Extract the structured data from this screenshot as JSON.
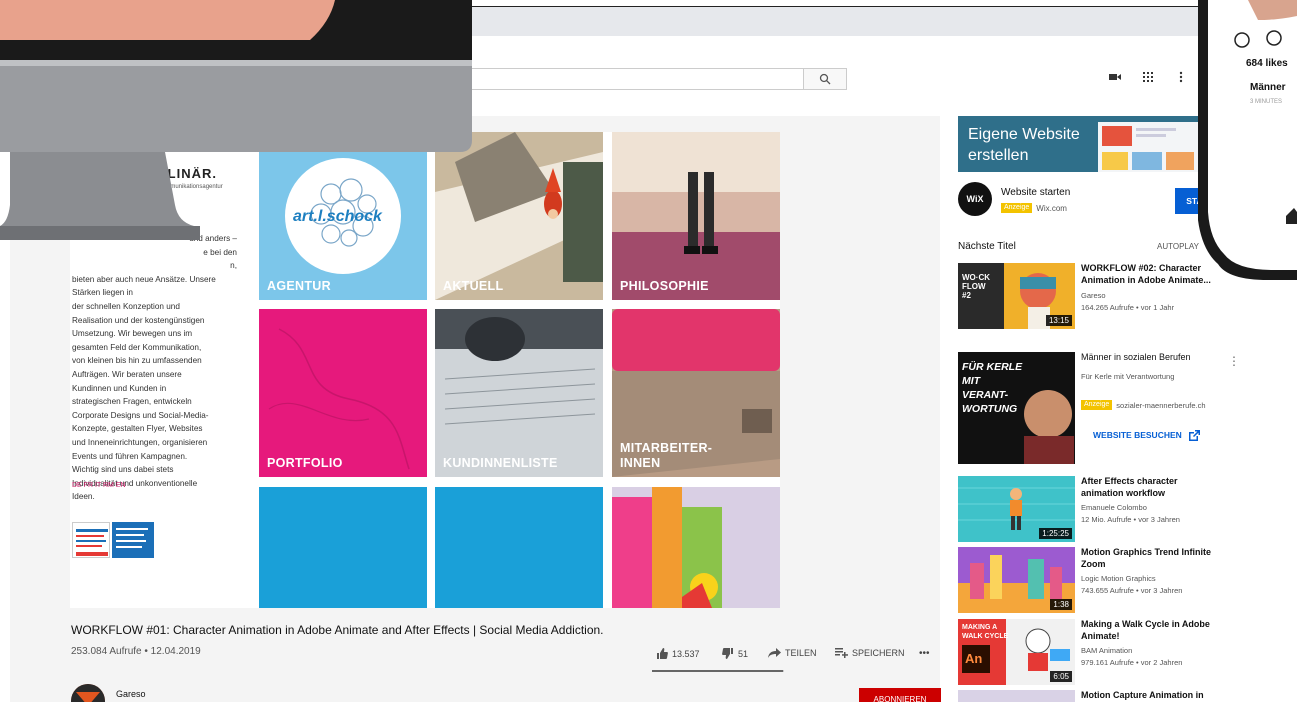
{
  "toolbar": {
    "search_icon": "search-icon",
    "icons": [
      "video-camera-icon",
      "apps-grid-icon",
      "more-vert-icon"
    ]
  },
  "website": {
    "title": "PLINÄR.",
    "subtitle": "Kommunikationsagentur",
    "text_lines": [
      "und anders –",
      "e bei den",
      "n,",
      "bieten aber auch neue Ansätze. Unsere Stärken liegen in",
      "der schnellen Konzeption und",
      "Realisation und der kostengünstigen",
      "Umsetzung. Wir bewegen uns im",
      "gesamten Feld der Kommunikation,",
      "von kleinen bis hin zu umfassenden",
      "Aufträgen. Wir beraten unsere",
      "Kundinnen und Kunden in",
      "strategischen Fragen, entwickeln",
      "Corporate Designs und Social-Media-",
      "Konzepte, gestalten Flyer, Websites",
      "und Inneneinrichtungen, organisieren",
      "Events und führen Kampagnen.",
      "Wichtig sind uns dabei stets",
      "Individualität und unkonventionelle",
      "Ideen."
    ],
    "languages": "DE FR IT RM EN",
    "logo_text": "art.l.schock",
    "tiles": [
      "AGENTUR",
      "AKTUELL",
      "PHILOSOPHIE",
      "PORTFOLIO",
      "KUNDINNENLISTE",
      "MITARBEITER-\nINNEN"
    ]
  },
  "video": {
    "title": "WORKFLOW #01: Character Animation in Adobe Animate and After Effects | Social Media Addiction.",
    "meta": "253.084 Aufrufe • 12.04.2019",
    "likes": "13.537",
    "dislikes": "51",
    "share": "TEILEN",
    "save": "SPEICHERN",
    "more": "•••",
    "like_ratio": 0.996,
    "channel": "Gareso",
    "subscribe": "ABONNIEREN"
  },
  "sidebar": {
    "ad_banner": {
      "text": "Eigene Website erstellen",
      "corner": "W"
    },
    "wix": {
      "logo": "WiX",
      "title": "Website starten",
      "badge": "Anzeige",
      "domain": "Wix.com",
      "button": "STARTEN"
    },
    "next_label": "Nächste Titel",
    "autoplay_label": "AUTOPLAY",
    "autoplay_on": true,
    "items": [
      {
        "title": "WORKFLOW #02: Character Animation in Adobe Animate...",
        "channel": "Gareso",
        "meta": "164.265 Aufrufe • vor 1 Jahr",
        "duration": "13:15",
        "thumb_text": "WO·CK\nFLOW\n#2"
      },
      {
        "title": "Männer in sozialen Berufen",
        "channel": "Für Kerle mit Verantwortung",
        "meta": "sozialer-maennerberufe.ch",
        "badge": "Anzeige",
        "button": "WEBSITE BESUCHEN",
        "thumb_text": "FÜR KERLE\nMIT\nVERANT-\nWORTUNG"
      },
      {
        "title": "After Effects character animation workflow",
        "channel": "Emanuele Colombo",
        "meta": "12 Mio. Aufrufe • vor 3 Jahren",
        "duration": "1:25:25"
      },
      {
        "title": "Motion Graphics Trend Infinite Zoom",
        "channel": "Logic Motion Graphics",
        "meta": "743.655 Aufrufe • vor 3 Jahren",
        "duration": "1:38"
      },
      {
        "title": "Making a Walk Cycle in Adobe Animate!",
        "channel": "BAM Animation",
        "meta": "979.161 Aufrufe • vor 2 Jahren",
        "duration": "6:05",
        "thumb_text": "MAKING A\nWALK CYCLE",
        "thumb_sub": "An"
      },
      {
        "title": "Motion Capture Animation in"
      }
    ]
  },
  "phone": {
    "likes": "684 likes",
    "caption": "Männer",
    "time": "3 MINUTES"
  },
  "colors": {
    "accent": "#065fd4",
    "subscribe": "#cc0000",
    "magenta": "#e6197c",
    "cyan": "#1aa0d8",
    "light_blue": "#7cc6ea"
  }
}
